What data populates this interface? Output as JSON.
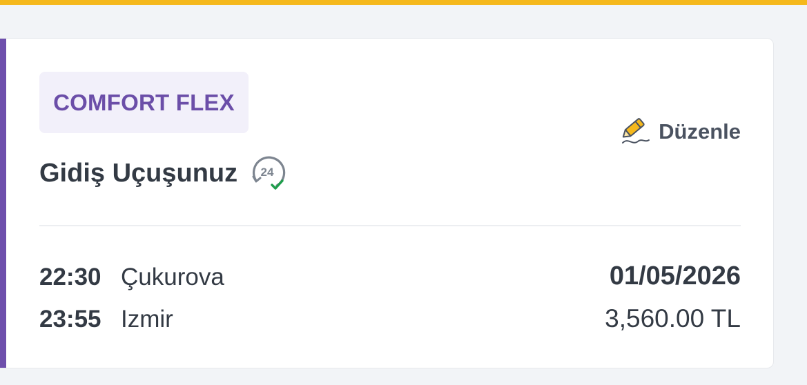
{
  "fare": {
    "badge": "COMFORT FLEX"
  },
  "flight": {
    "title": "Gidiş Uçuşunuz",
    "support_icon_text": "24",
    "edit_label": "Düzenle",
    "departure": {
      "time": "22:30",
      "city": "Çukurova"
    },
    "arrival": {
      "time": "23:55",
      "city": "Izmir"
    },
    "date": "01/05/2026",
    "price": "3,560.00 TL"
  },
  "colors": {
    "top_bar": "#f5b81c",
    "accent": "#6e4fac",
    "badge_bg": "#f2f0fa",
    "badge_text": "#6b4ea8",
    "check": "#1f9d4c",
    "pencil": "#f5b81c"
  },
  "icons": {
    "support": "24-hour-support-icon",
    "edit": "pencil-edit-icon"
  }
}
